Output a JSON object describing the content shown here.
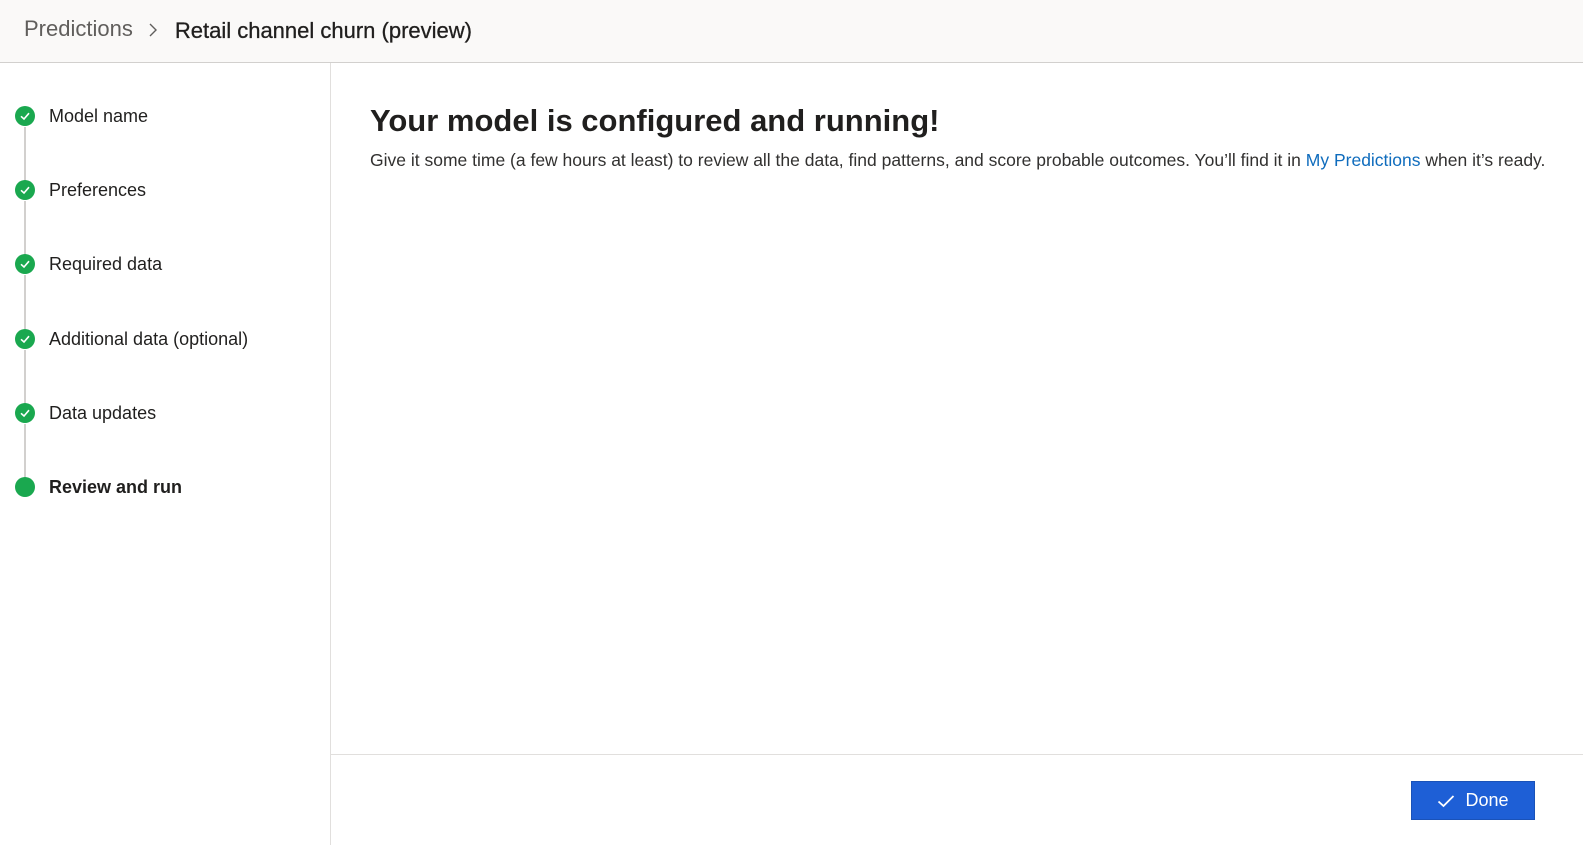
{
  "breadcrumb": {
    "parent": "Predictions",
    "current": "Retail channel churn (preview)"
  },
  "steps": [
    {
      "label": "Model name",
      "status": "complete"
    },
    {
      "label": "Preferences",
      "status": "complete"
    },
    {
      "label": "Required data",
      "status": "complete"
    },
    {
      "label": "Additional data (optional)",
      "status": "complete"
    },
    {
      "label": "Data updates",
      "status": "complete"
    },
    {
      "label": "Review and run",
      "status": "current"
    }
  ],
  "main": {
    "title": "Your model is configured and running!",
    "description_before": "Give it some time (a few hours at least) to review all the data, find patterns, and score probable outcomes. You’ll find it in ",
    "description_link": "My Predictions",
    "description_after": " when it’s ready."
  },
  "footer": {
    "done_label": "Done"
  },
  "colors": {
    "accent": "#1e5fd6",
    "step_complete": "#1aa84f",
    "link": "#0f6cbd"
  },
  "icons": {
    "breadcrumb_separator": "chevron-right-icon",
    "step_complete": "checkmark-circle-icon",
    "step_current": "filled-circle-icon",
    "done": "checkmark-icon"
  }
}
